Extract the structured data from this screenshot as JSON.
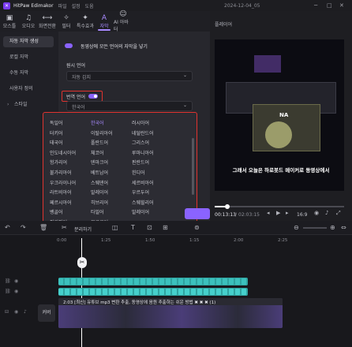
{
  "window": {
    "app_name": "HitPaw Edimakor",
    "menus": [
      "파일",
      "설정",
      "도움"
    ],
    "date": "2024-12-04_05"
  },
  "toolbar": {
    "items": [
      {
        "icon": "media-icon",
        "glyph": "▣",
        "label": "모스틀"
      },
      {
        "icon": "audio-icon",
        "glyph": "♫",
        "label": "오디오"
      },
      {
        "icon": "transition-icon",
        "glyph": "⟷",
        "label": "화면전환"
      },
      {
        "icon": "filter-icon",
        "glyph": "✧",
        "label": "필터"
      },
      {
        "icon": "effect-icon",
        "glyph": "✦",
        "label": "특수효과"
      },
      {
        "icon": "subtitle-icon",
        "glyph": "A",
        "label": "자막",
        "active": true
      },
      {
        "icon": "ai-avatar-icon",
        "glyph": "☺",
        "label": "AI 아바터"
      }
    ]
  },
  "left_nav": {
    "items": [
      "자동 자막 생성",
      "로컬 자막",
      "수동 자막",
      "사용자 정의",
      "스타일"
    ],
    "selected": 0
  },
  "panel": {
    "toggle_label": "동영상에 모든 언어의 자막을 넣기",
    "source_label": "원시 언어",
    "source_value": "자동 감지",
    "target_label": "번역 언어",
    "target_value": "한국어",
    "languages": [
      [
        "독일어",
        "한국어",
        "러시아어"
      ],
      [
        "터키어",
        "이탈리아어",
        "네덜란드어"
      ],
      [
        "태국어",
        "폴란드어",
        "그리스어"
      ],
      [
        "인도네시아어",
        "체코어",
        "루마니아어"
      ],
      [
        "헝가리어",
        "덴마크어",
        "핀란드어"
      ],
      [
        "불가리아어",
        "베트남어",
        "힌디어"
      ],
      [
        "우크라이나어",
        "스웨덴어",
        "세르비아어"
      ],
      [
        "라트비아어",
        "말레이어",
        "우르두어"
      ],
      [
        "페르시아어",
        "히브리어",
        "스웨힐리어"
      ],
      [
        "벵골어",
        "타밀어",
        "말레이어"
      ],
      [
        "필리핀어",
        "모로코어",
        ""
      ]
    ],
    "selected_language": "한국어"
  },
  "player": {
    "title": "플레이어",
    "caption": "그래서 오늘은 하로봇드 메이커로 동영상에서",
    "overlay_tag": "NA",
    "time_current": "00:13:13",
    "time_total": "02:03:15",
    "ratio": "16:9",
    "progress_fraction": 0.1
  },
  "timeline": {
    "toolbar_label": "분리하기",
    "ruler": [
      "0:00",
      "1:25",
      "1:50",
      "1:15",
      "2:00",
      "2:25"
    ],
    "clip_label": "2:03 [최신] 유튜브 mp3 변환 추출, 동영상에 음원 추출하는 쉬운 방법 ✖ ✖ ✖ (1)",
    "cover_label": "커버"
  }
}
